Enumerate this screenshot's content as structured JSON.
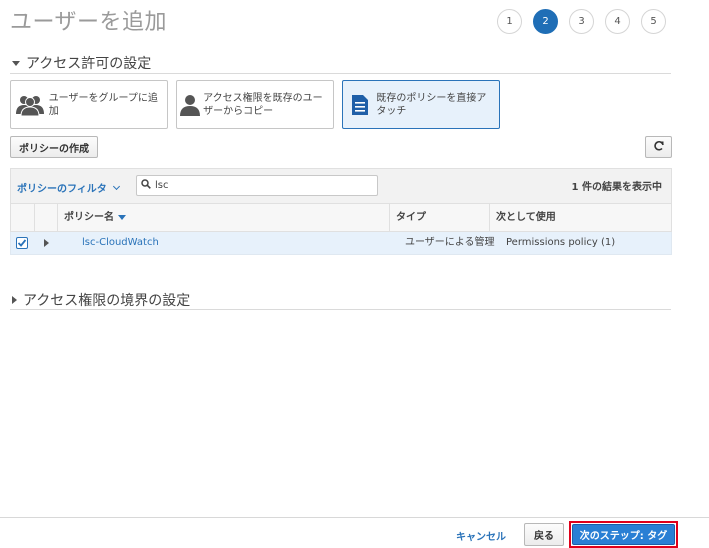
{
  "page": {
    "title": "ユーザーを追加"
  },
  "steps": [
    "1",
    "2",
    "3",
    "4",
    "5"
  ],
  "active_step": "2",
  "permissions_section": {
    "title": "アクセス許可の設定"
  },
  "options": [
    {
      "label": "ユーザーをグループに追加",
      "icon": "user-group-icon",
      "selected": false
    },
    {
      "label": "アクセス権限を既存のユーザーからコピー",
      "icon": "user-icon",
      "selected": false
    },
    {
      "label": "既存のポリシーを直接アタッチ",
      "icon": "document-icon",
      "selected": true
    }
  ],
  "toolbar": {
    "create_policy_label": "ポリシーの作成",
    "refresh_icon": "refresh-icon"
  },
  "filter": {
    "label": "ポリシーのフィルタ",
    "search_value": "lsc",
    "result_count": "1 件の結果を表示中"
  },
  "table": {
    "columns": {
      "name": "ポリシー名",
      "type": "タイプ",
      "used_as": "次として使用"
    },
    "rows": [
      {
        "name": "lsc-CloudWatch",
        "type": "ユーザーによる管理",
        "used_as": "Permissions policy (1)",
        "checked": true
      }
    ]
  },
  "boundary_section": {
    "title": "アクセス権限の境界の設定"
  },
  "footer": {
    "cancel": "キャンセル",
    "back": "戻る",
    "next": "次のステップ: タグ"
  },
  "colors": {
    "accent": "#2a73b9",
    "active_step": "#1f6eb6",
    "highlight_row": "#e7f1fb",
    "next_outline": "#e0001a"
  }
}
